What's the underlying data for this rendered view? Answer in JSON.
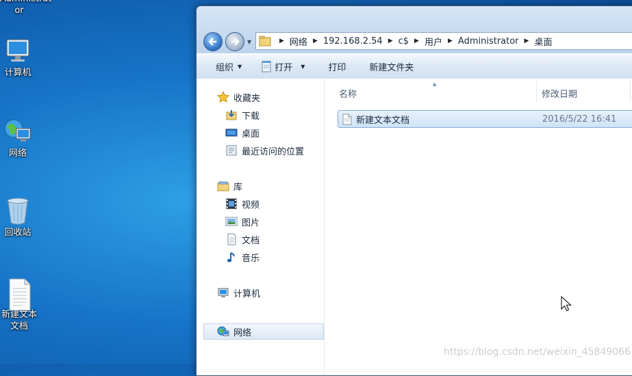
{
  "desktop": {
    "icons": [
      {
        "label": "Administrat or",
        "icon": "user-icon"
      },
      {
        "label": "计算机",
        "icon": "computer-icon"
      },
      {
        "label": "网络",
        "icon": "network-icon"
      },
      {
        "label": "回收站",
        "icon": "recycle-bin-icon"
      },
      {
        "label": "新建文本文档",
        "icon": "text-file-icon"
      }
    ]
  },
  "explorer": {
    "address": {
      "crumbs": [
        "网络",
        "192.168.2.54",
        "c$",
        "用户",
        "Administrator",
        "桌面"
      ]
    },
    "toolbar": {
      "organize": "组织",
      "open": "打开",
      "print": "打印",
      "new_folder": "新建文件夹"
    },
    "sidebar": {
      "favorites": "收藏夹",
      "downloads": "下载",
      "desktop": "桌面",
      "recent": "最近访问的位置",
      "libraries": "库",
      "videos": "视频",
      "pictures": "图片",
      "documents": "文档",
      "music": "音乐",
      "computer": "计算机",
      "network": "网络"
    },
    "columns": {
      "name": "名称",
      "modified": "修改日期"
    },
    "files": [
      {
        "name": "新建文本文档",
        "modified": "2016/5/22 16:41",
        "icon": "text-file-icon"
      }
    ]
  },
  "watermark": "https://blog.csdn.net/weixin_45849066",
  "colors": {
    "desktop_bg": "#1673c7",
    "selection": "#cfe3f7",
    "window_chrome": "#bcd4ee"
  }
}
